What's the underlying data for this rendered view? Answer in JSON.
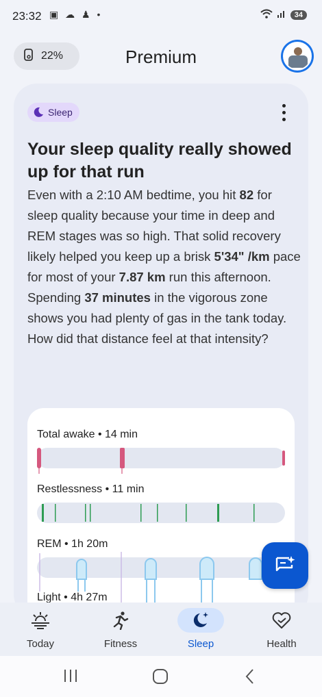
{
  "status": {
    "time": "23:32",
    "battery": "34"
  },
  "header": {
    "battery_percent": "22%",
    "title": "Premium"
  },
  "card": {
    "chip_label": "Sleep",
    "headline": "Your sleep quality really showed up for that run",
    "paragraph1": {
      "p1": "Even with a 2:10 AM bedtime, you hit ",
      "b1": "82",
      "p2": " for sleep quality because your time in deep and REM stages was so high. That solid recovery likely helped you keep up a brisk ",
      "b2": "5'34\" /km",
      "p3": " pace for most of your ",
      "b3": "7.87 km",
      "p4": " run this afternoon."
    },
    "paragraph2": {
      "p1": "Spending ",
      "b1": "37 minutes",
      "p2": " in the vigorous zone shows you had plenty of gas in the tank today. How did that distance feel at that intensity?"
    }
  },
  "sleep_stages": {
    "total_awake": "Total awake • 14 min",
    "restlessness": "Restlessness • 11 min",
    "rem": "REM • 1h 20m",
    "light": "Light • 4h 27m"
  },
  "nav": {
    "today": "Today",
    "fitness": "Fitness",
    "sleep": "Sleep",
    "health": "Health"
  },
  "colors": {
    "accent": "#0b57d0",
    "awake": "#d5587e",
    "restless": "#2e9c53",
    "rem": "#8cc8ee"
  }
}
